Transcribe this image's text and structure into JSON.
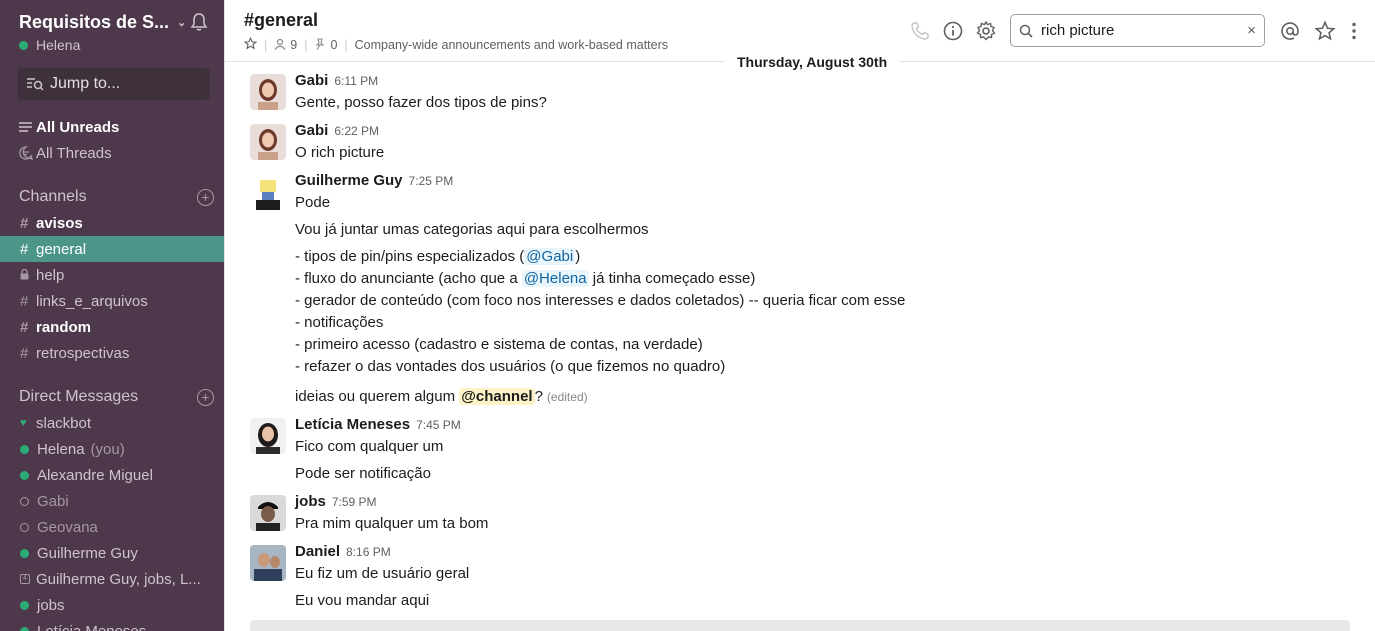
{
  "workspace": {
    "name": "Requisitos de S...",
    "user": "Helena"
  },
  "jump": {
    "label": "Jump to..."
  },
  "nav": {
    "unreads": "All Unreads",
    "threads": "All Threads"
  },
  "channels": {
    "header": "Channels",
    "items": [
      {
        "prefix": "#",
        "label": "avisos",
        "state": "unread"
      },
      {
        "prefix": "#",
        "label": "general",
        "state": "active"
      },
      {
        "prefix": "lock",
        "label": "help",
        "state": "normal"
      },
      {
        "prefix": "#",
        "label": "links_e_arquivos",
        "state": "normal"
      },
      {
        "prefix": "#",
        "label": "random",
        "state": "unread"
      },
      {
        "prefix": "#",
        "label": "retrospectivas",
        "state": "normal"
      }
    ]
  },
  "dms": {
    "header": "Direct Messages",
    "items": [
      {
        "label": "slackbot",
        "status": "bot"
      },
      {
        "label": "Helena",
        "you": "(you)",
        "status": "online"
      },
      {
        "label": "Alexandre Miguel",
        "status": "online"
      },
      {
        "label": "Gabi",
        "status": "away"
      },
      {
        "label": "Geovana",
        "status": "away"
      },
      {
        "label": "Guilherme Guy",
        "status": "online"
      },
      {
        "label": "Guilherme Guy, jobs, L...",
        "status": "group"
      },
      {
        "label": "jobs",
        "status": "online"
      },
      {
        "label": "Letícia Meneses",
        "status": "online"
      }
    ]
  },
  "channel": {
    "title": "#general",
    "members": "9",
    "pins": "0",
    "topic": "Company-wide announcements and work-based matters"
  },
  "search": {
    "value": "rich picture",
    "clear": "×"
  },
  "date_divider": "Thursday, August 30th",
  "messages": {
    "m1": {
      "sender": "Gabi",
      "time": "6:11 PM",
      "l1": "Gente, posso fazer dos tipos de pins?"
    },
    "m2": {
      "sender": "Gabi",
      "time": "6:22 PM",
      "l1": "O rich picture"
    },
    "m3": {
      "sender": "Guilherme Guy",
      "time": "7:25 PM",
      "l1": "Pode",
      "l2": "Vou já juntar umas categorias aqui para escolhermos",
      "l3a": "- tipos de pin/pins especializados (",
      "l3m": "@Gabi",
      "l3b": ")",
      "l4a": "- fluxo do anunciante (acho que a ",
      "l4m": "@Helena",
      "l4b": " já tinha começado esse)",
      "l5": "- gerador de conteúdo (com foco nos interesses e dados coletados) -- queria ficar com esse",
      "l6": "- notificações",
      "l7": "- primeiro acesso (cadastro e sistema de contas, na verdade)",
      "l8": "- refazer o das vontades dos usuários (o que fizemos no quadro)",
      "l9a": "ideias ou querem algum ",
      "l9m": "@channel",
      "l9b": "?",
      "edited": "(edited)"
    },
    "m4": {
      "sender": "Letícia Meneses",
      "time": "7:45 PM",
      "l1": "Fico com qualquer um",
      "l2": "Pode ser notificação"
    },
    "m5": {
      "sender": "jobs",
      "time": "7:59 PM",
      "l1": "Pra mim qualquer um ta bom"
    },
    "m6": {
      "sender": "Daniel",
      "time": "8:16 PM",
      "l1": "Eu fiz um de usuário geral",
      "l2": "Eu vou mandar aqui"
    }
  },
  "colors": {
    "sidebar": "#4d394b",
    "active": "#4c9689",
    "online": "#2bac76",
    "mention": "#1264a3"
  }
}
